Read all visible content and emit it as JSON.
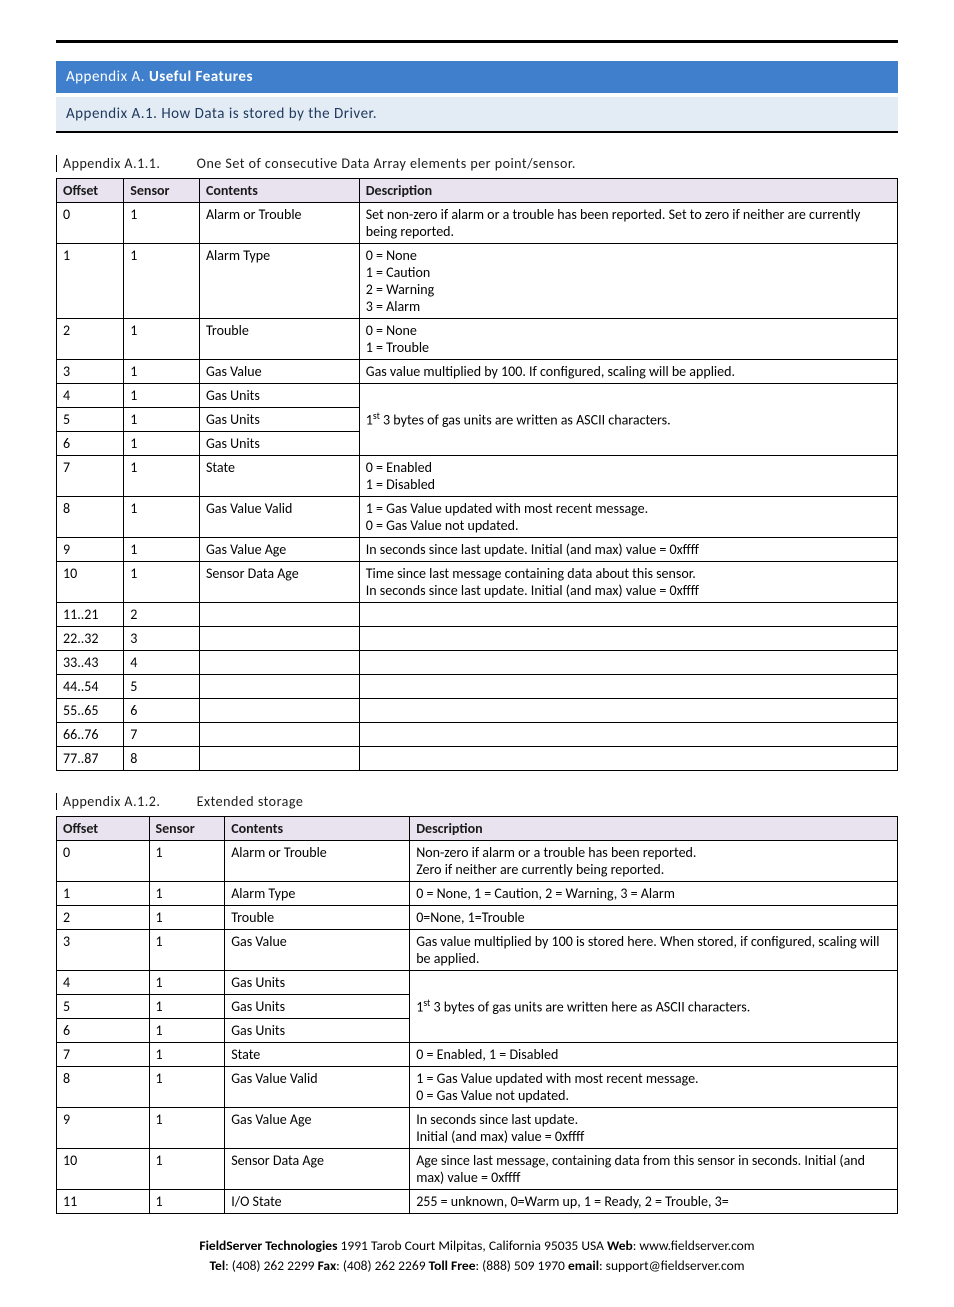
{
  "banner": {
    "prefix": "Appendix A. ",
    "title": "Useful Features"
  },
  "sub_banner": "Appendix A.1. How Data is stored by the Driver.",
  "section1": {
    "num": "Appendix A.1.1.",
    "title": "One Set of consecutive Data Array elements per point/sensor."
  },
  "section2": {
    "num": "Appendix A.1.2.",
    "title": "Extended storage"
  },
  "table1": {
    "headers": [
      "Offset",
      "Sensor",
      "Contents",
      "Description"
    ],
    "rows": [
      {
        "c": [
          "0",
          "1",
          "Alarm or Trouble",
          "Set non-zero if alarm or a trouble has been reported.  Set to zero if neither are currently being reported."
        ]
      },
      {
        "c": [
          "1",
          "1",
          "Alarm Type",
          "0 = None\n1 = Caution\n2 = Warning\n3 = Alarm"
        ]
      },
      {
        "c": [
          "2",
          "1",
          "Trouble",
          "0 = None\n1 = Trouble"
        ]
      },
      {
        "c": [
          "3",
          "1",
          "Gas Value",
          "Gas value multiplied by 100.  If configured, scaling will be applied."
        ]
      },
      {
        "c": [
          "4",
          "1",
          "Gas Units"
        ],
        "rowspan_desc": 3,
        "desc": "1<sup>st</sup> 3 bytes of gas units are written as ASCII characters."
      },
      {
        "c": [
          "5",
          "1",
          "Gas Units"
        ],
        "skip_desc": true
      },
      {
        "c": [
          "6",
          "1",
          "Gas Units"
        ],
        "skip_desc": true
      },
      {
        "c": [
          "7",
          "1",
          "State",
          "0 = Enabled\n1 = Disabled"
        ]
      },
      {
        "c": [
          "8",
          "1",
          "Gas Value Valid",
          "1 = Gas Value updated with most recent message.\n0 = Gas Value not updated."
        ]
      },
      {
        "c": [
          "9",
          "1",
          "Gas Value Age",
          "In seconds since last update. Initial (and max) value =  0xffff"
        ]
      },
      {
        "c": [
          "10",
          "1",
          "Sensor Data Age",
          "Time since last message containing data about this sensor.\nIn seconds since last update. Initial (and max) value =  0xffff"
        ]
      },
      {
        "c": [
          "11..21",
          "2",
          "",
          ""
        ]
      },
      {
        "c": [
          "22..32",
          "3",
          "",
          ""
        ]
      },
      {
        "c": [
          "33..43",
          "4",
          "",
          ""
        ]
      },
      {
        "c": [
          "44..54",
          "5",
          "",
          ""
        ]
      },
      {
        "c": [
          "55..65",
          "6",
          "",
          ""
        ]
      },
      {
        "c": [
          "66..76",
          "7",
          "",
          ""
        ]
      },
      {
        "c": [
          "77..87",
          "8",
          "",
          ""
        ]
      }
    ]
  },
  "table2": {
    "headers": [
      "Offset",
      "Sensor",
      "Contents",
      "Description"
    ],
    "rows": [
      {
        "c": [
          "0",
          "1",
          "Alarm or Trouble",
          "Non-zero if alarm or a trouble has been reported.\nZero if neither are currently being reported."
        ]
      },
      {
        "c": [
          "1",
          "1",
          "Alarm Type",
          "0 = None, 1 = Caution, 2 = Warning, 3 = Alarm"
        ]
      },
      {
        "c": [
          "2",
          "1",
          "Trouble",
          "0=None, 1=Trouble"
        ]
      },
      {
        "c": [
          "3",
          "1",
          "Gas Value",
          "Gas value multiplied by 100 is stored here.  When stored, if configured, scaling will be applied."
        ]
      },
      {
        "c": [
          "4",
          "1",
          "Gas Units"
        ],
        "rowspan_desc": 3,
        "desc": "1<sup>st</sup> 3 bytes of gas units are written here as ASCII characters."
      },
      {
        "c": [
          "5",
          "1",
          "Gas Units"
        ],
        "skip_desc": true
      },
      {
        "c": [
          "6",
          "1",
          "Gas Units"
        ],
        "skip_desc": true
      },
      {
        "c": [
          "7",
          "1",
          "State",
          "0 = Enabled, 1 = Disabled"
        ]
      },
      {
        "c": [
          "8",
          "1",
          "Gas Value Valid",
          "1 = Gas Value updated with most recent message.\n0 = Gas Value not updated."
        ]
      },
      {
        "c": [
          "9",
          "1",
          "Gas Value Age",
          "In seconds since last update.\nInitial (and max) value = 0xffff"
        ]
      },
      {
        "c": [
          "10",
          "1",
          "Sensor Data Age",
          "Age since last message, containing data from this sensor in seconds.  Initial (and max) value = 0xffff"
        ]
      },
      {
        "c": [
          "11",
          "1",
          "I/O State",
          "255 = unknown, 0=Warm up,  1 = Ready, 2 = Trouble, 3="
        ]
      }
    ]
  },
  "col_widths": {
    "t1": [
      "8%",
      "9%",
      "19%",
      "64%"
    ],
    "t2": [
      "11%",
      "9%",
      "22%",
      "58%"
    ]
  },
  "footer": {
    "l1_a": "FieldServer Technologies",
    "l1_b": " 1991 Tarob Court Milpitas, California 95035 USA   ",
    "l1_c": "Web",
    "l1_d": ": www.fieldserver.com",
    "l2_a": "Tel",
    "l2_b": ": (408) 262 2299   ",
    "l2_c": "Fax",
    "l2_d": ": (408) 262 2269   ",
    "l2_e": "Toll Free",
    "l2_f": ": (888) 509 1970   ",
    "l2_g": "email",
    "l2_h": ": support@fieldserver.com"
  }
}
